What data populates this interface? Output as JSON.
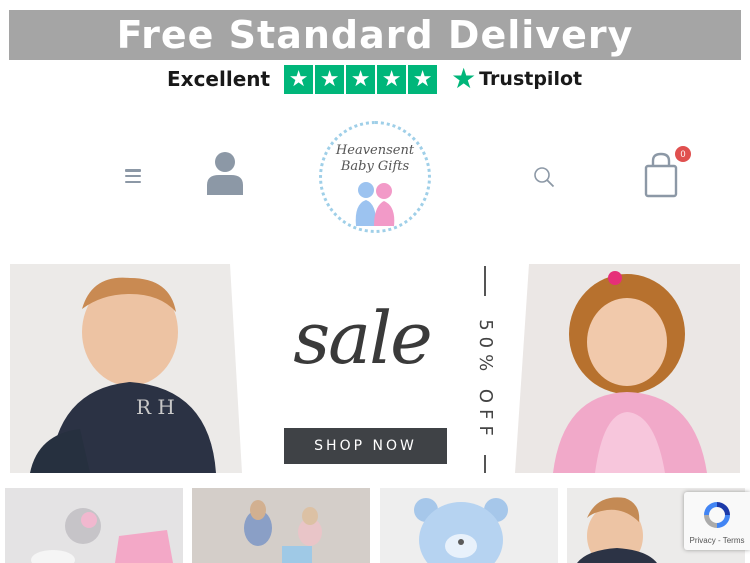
{
  "banner": {
    "text": "Free Standard Delivery"
  },
  "trustpilot": {
    "rating_text": "Excellent",
    "brand": "Trustpilot",
    "stars": 5
  },
  "header": {
    "logo_line1": "Heavensent",
    "logo_line2": "Baby Gifts",
    "cart_count": "0"
  },
  "hero": {
    "sale_text": "sale",
    "discount_text": "50% OFF",
    "shop_button": "SHOP NOW"
  },
  "recaptcha": {
    "links": "Privacy - Terms"
  },
  "colors": {
    "banner_bg": "#a5a5a5",
    "trust_green": "#00b67a",
    "badge_red": "#e0504f",
    "icon_gray": "#8c98a6"
  },
  "icons": [
    "menu-icon",
    "account-icon",
    "search-icon",
    "cart-icon",
    "recaptcha-icon"
  ]
}
